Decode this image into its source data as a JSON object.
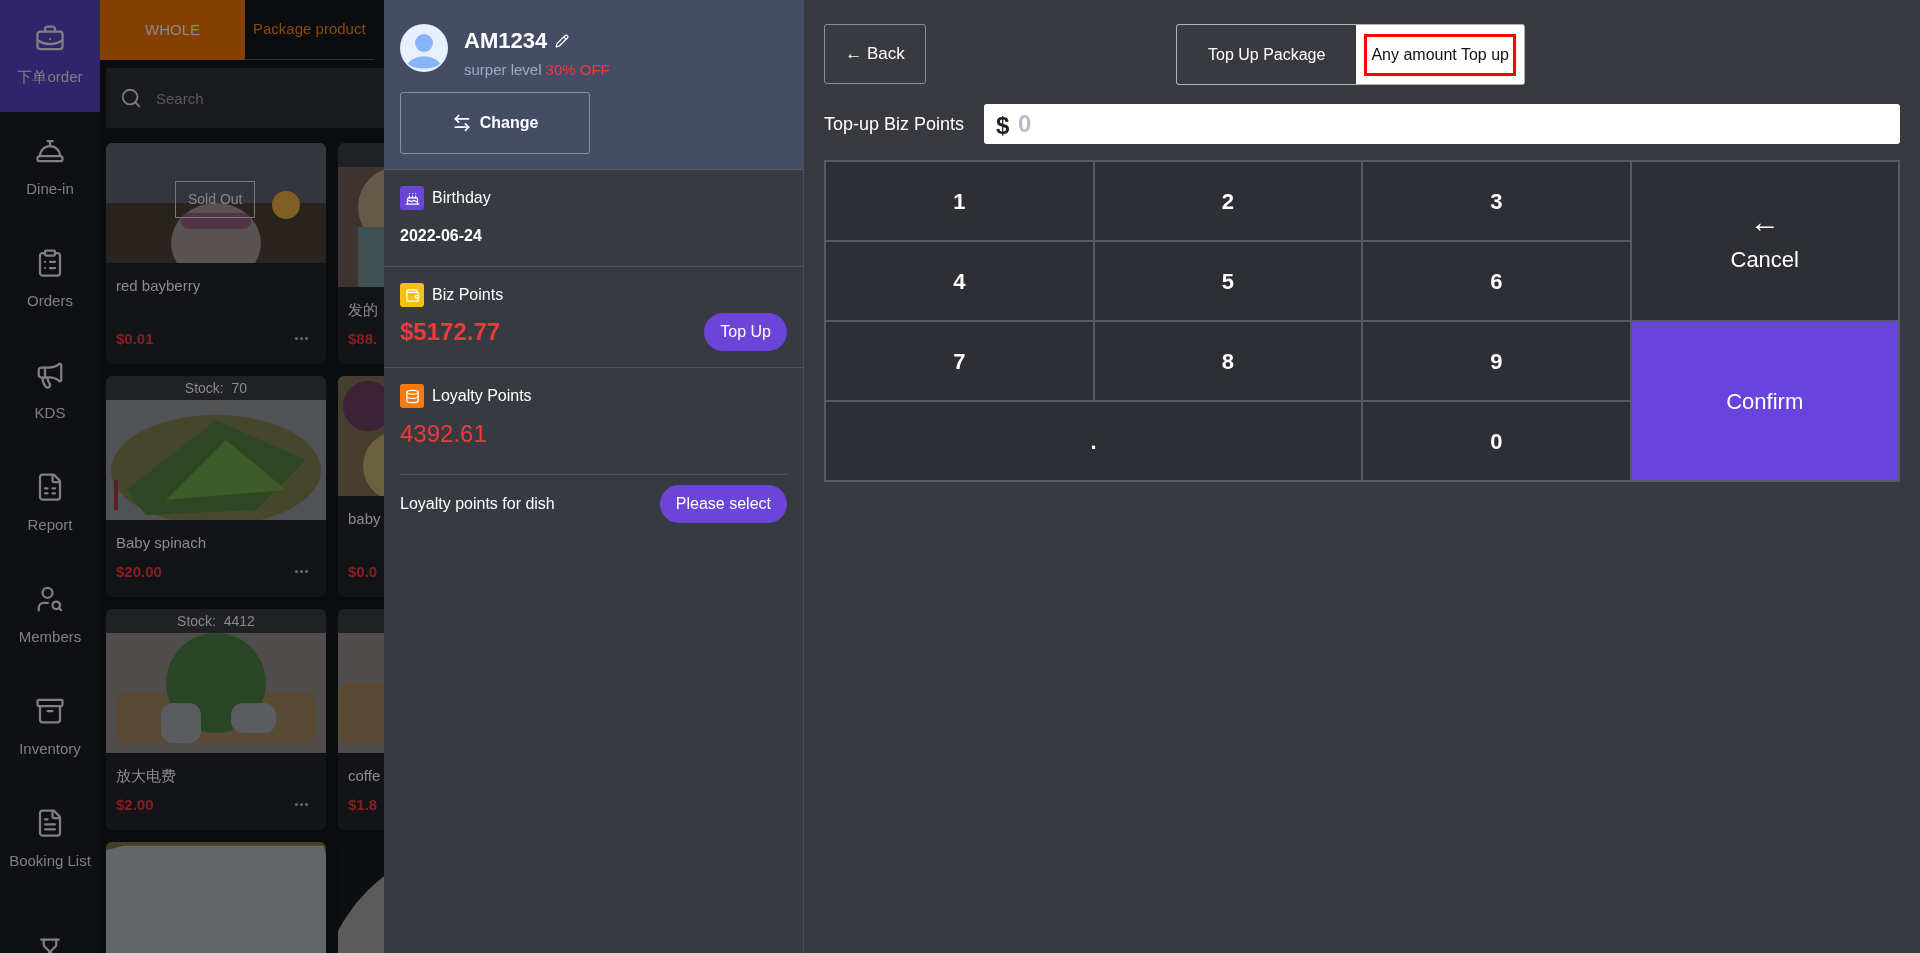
{
  "sidebar": {
    "items": [
      {
        "label": "下单order",
        "selected": true
      },
      {
        "label": "Dine-in",
        "selected": false
      },
      {
        "label": "Orders",
        "selected": false
      },
      {
        "label": "KDS",
        "selected": false
      },
      {
        "label": "Report",
        "selected": false
      },
      {
        "label": "Members",
        "selected": false
      },
      {
        "label": "Inventory",
        "selected": false
      },
      {
        "label": "Booking List",
        "selected": false
      },
      {
        "selected": false
      }
    ]
  },
  "category_tabs": [
    {
      "label": "WHOLE",
      "selected": true
    },
    {
      "label": "Package product",
      "selected": false
    }
  ],
  "search": {
    "placeholder": "Search"
  },
  "products": [
    {
      "name": "red bayberry",
      "price": "$0.01",
      "badge": "Sold Out"
    },
    {
      "name": "发的",
      "price": "$88.",
      "header": true
    },
    {
      "name": "Baby spinach",
      "price": "$20.00",
      "stock": "Stock:  70"
    },
    {
      "name": "baby",
      "price": "$0.0"
    },
    {
      "name": "放大电费",
      "price": "$2.00",
      "stock": "Stock:  4412"
    },
    {
      "name": "coffe",
      "price": "$1.8",
      "header": true
    },
    {
      "kind": "picture"
    },
    {
      "kind": "picture"
    }
  ],
  "member": {
    "name": "AM1234",
    "level": "surper level",
    "discount": "30% OFF",
    "change_button": "Change",
    "birthday": {
      "label": "Birthday",
      "value": "2022-06-24"
    },
    "biz_points": {
      "label": "Biz Points",
      "value": "$5172.77",
      "button": "Top Up"
    },
    "loyalty_points": {
      "label": "Loyalty Points",
      "value": "4392.61"
    },
    "dish_points": {
      "label": "Loyalty points for dish",
      "button": "Please select"
    }
  },
  "topup": {
    "back_button": "← Back",
    "modes": [
      {
        "label": "Top Up Package",
        "selected": false,
        "highlighted": false
      },
      {
        "label": "Any amount Top up",
        "selected": true,
        "highlighted": true
      }
    ],
    "amount_label": "Top-up Biz Points",
    "currency": "$",
    "placeholder": "0",
    "keys": [
      {
        "label": "1",
        "kind": "digit"
      },
      {
        "label": "2",
        "kind": "digit"
      },
      {
        "label": "3",
        "kind": "digit"
      },
      {
        "label": "←",
        "label2": "Cancel",
        "kind": "cancel"
      },
      {
        "label": "4",
        "kind": "digit"
      },
      {
        "label": "5",
        "kind": "digit"
      },
      {
        "label": "6",
        "kind": "digit"
      },
      {
        "label": "7",
        "kind": "digit"
      },
      {
        "label": "8",
        "kind": "digit"
      },
      {
        "label": "9",
        "kind": "digit"
      },
      {
        "label": "Confirm",
        "kind": "confirm"
      },
      {
        "label": ".",
        "kind": "wide"
      },
      {
        "label": "0",
        "kind": "digit"
      }
    ]
  }
}
